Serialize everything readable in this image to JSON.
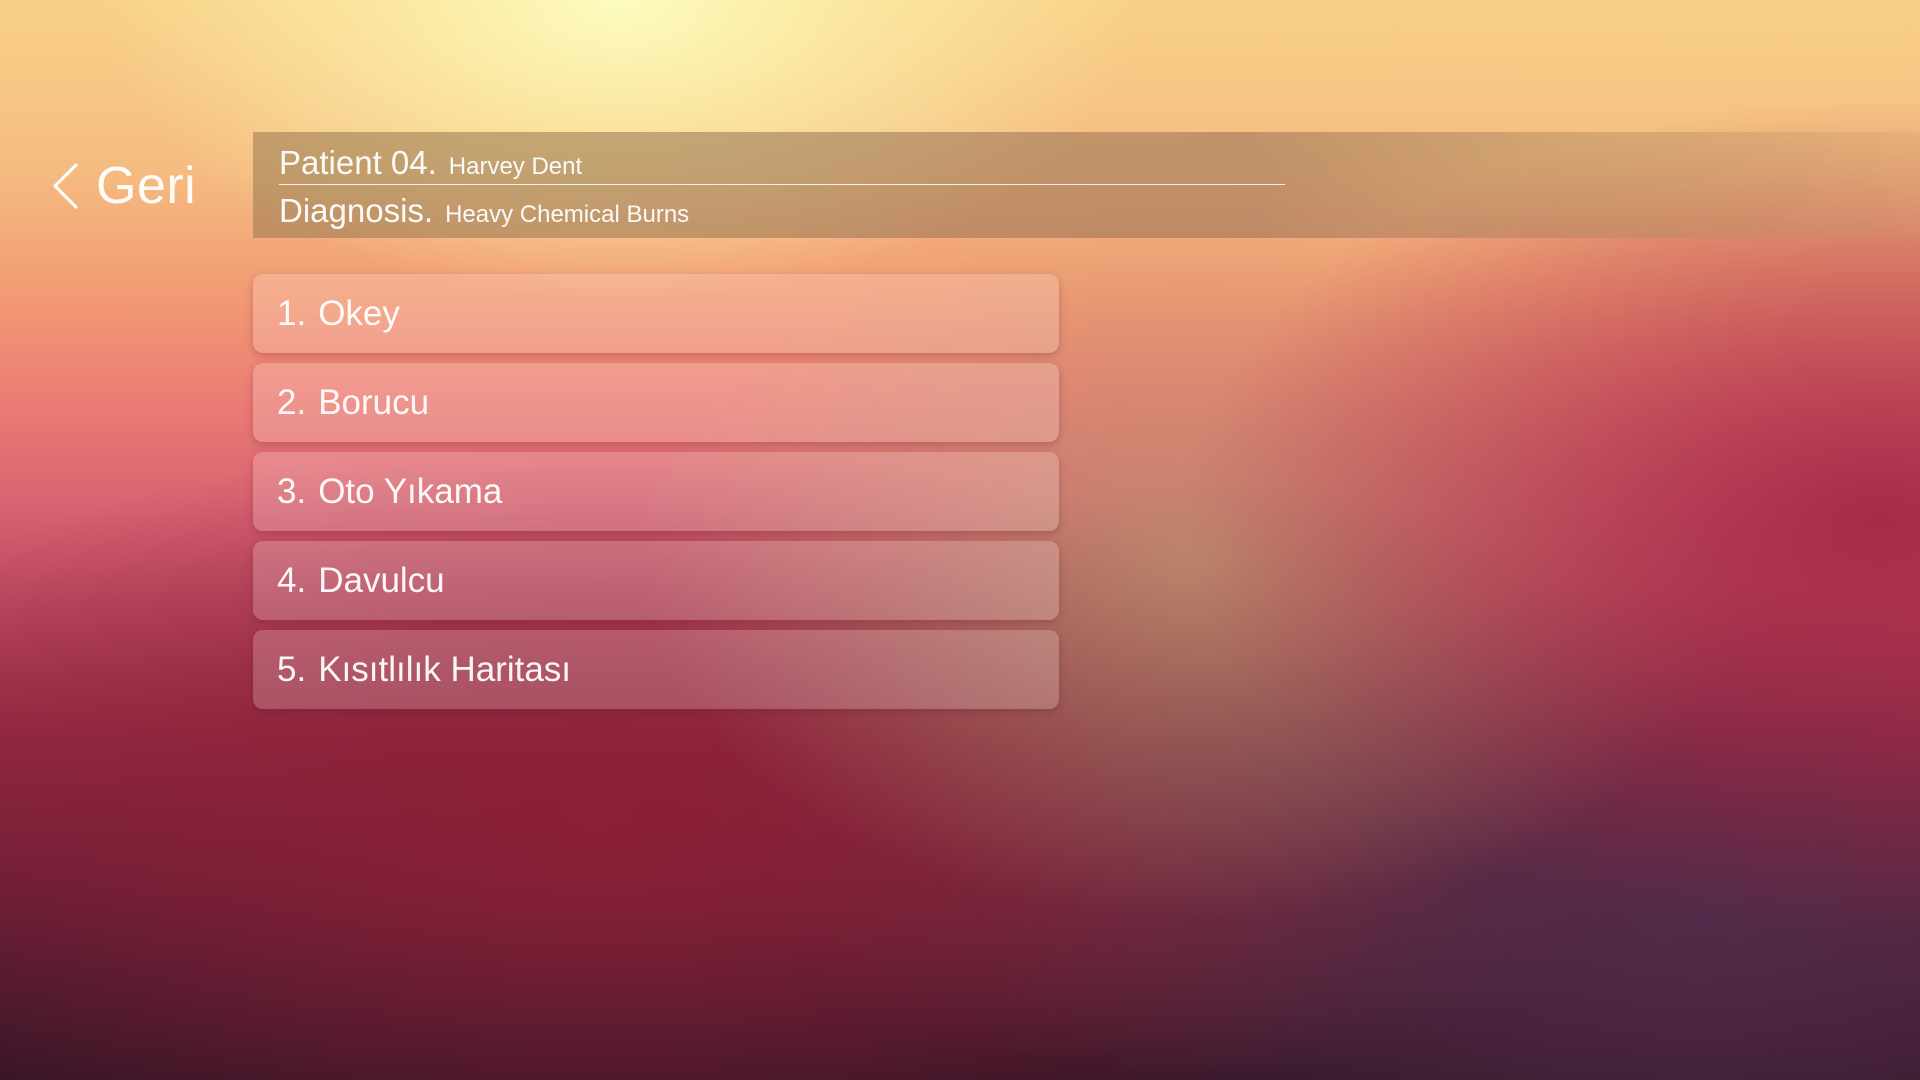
{
  "nav": {
    "back_label": "Geri"
  },
  "header": {
    "patient_key": "Patient 04.",
    "patient_name": "Harvey Dent",
    "diagnosis_key": "Diagnosis.",
    "diagnosis_value": "Heavy Chemical Burns"
  },
  "menu": {
    "items": [
      {
        "number": "1.",
        "label": "Okey"
      },
      {
        "number": "2.",
        "label": "Borucu"
      },
      {
        "number": "3.",
        "label": "Oto Yıkama"
      },
      {
        "number": "4.",
        "label": "Davulcu"
      },
      {
        "number": "5.",
        "label": "Kısıtlılık Haritası"
      }
    ]
  },
  "icons": {
    "back": "chevron-left-icon"
  }
}
